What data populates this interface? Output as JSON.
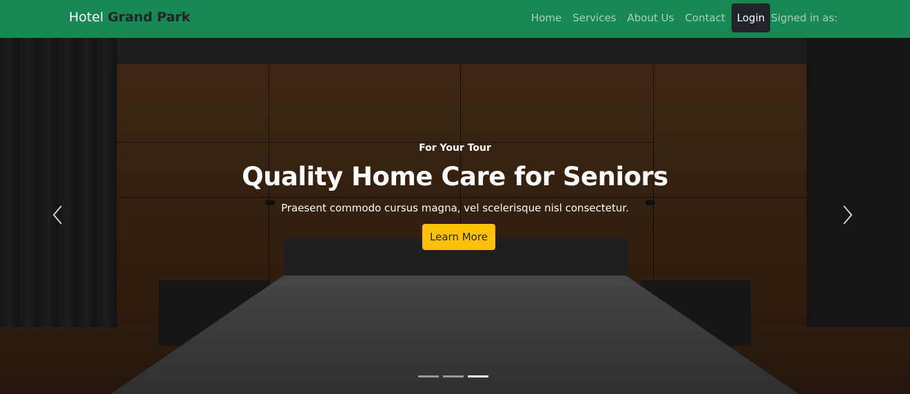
{
  "navbar": {
    "brand_prefix": "Hotel",
    "brand_strong": "Grand Park",
    "links": [
      "Home",
      "Services",
      "About Us",
      "Contact"
    ],
    "login_label": "Login",
    "signed_in_label": "Signed in as:",
    "bg_color": "#198754"
  },
  "hero": {
    "kicker": "For Your Tour",
    "headline": "Quality Home Care for Seniors",
    "subtext": "Praesent commodo cursus magna, vel scelerisque nisl consectetur.",
    "cta_label": "Learn More",
    "cta_color": "#ffc107",
    "prev_icon": "chevron-left-icon",
    "next_icon": "chevron-right-icon",
    "slide_count": 3,
    "active_slide": 3
  }
}
